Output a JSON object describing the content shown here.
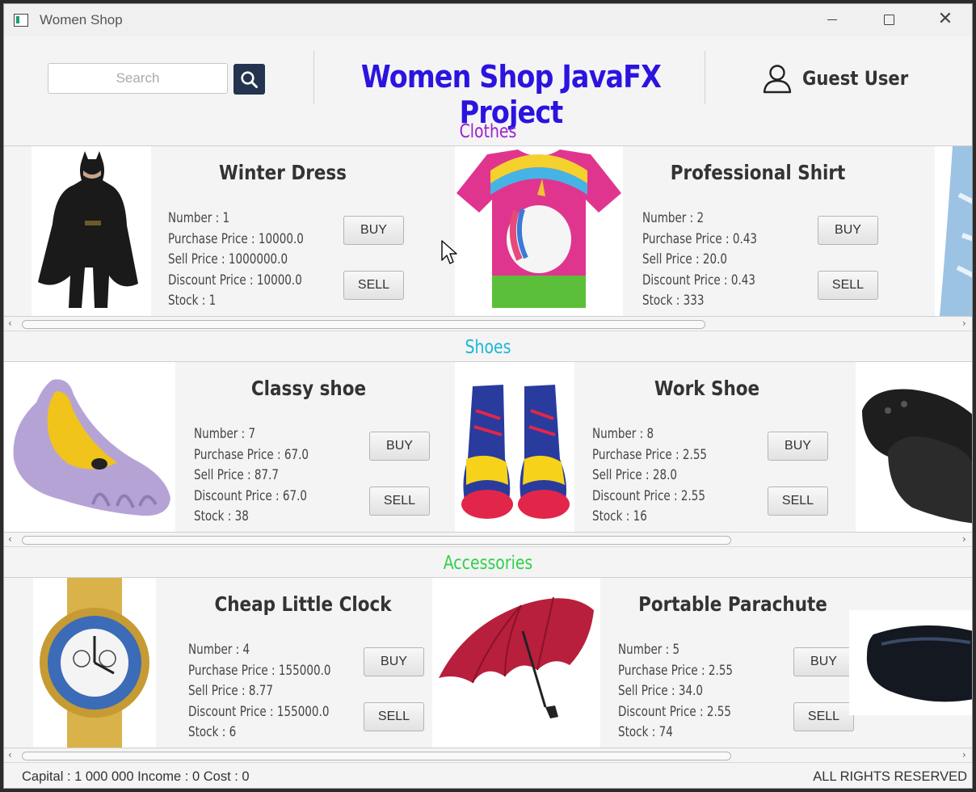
{
  "window": {
    "title": "Women Shop"
  },
  "header": {
    "search_placeholder": "Search",
    "title": "Women Shop JavaFX Project",
    "user": "Guest User"
  },
  "sections": [
    {
      "title": "Clothes",
      "color": "#9a1fd0",
      "products": [
        {
          "name": "Winter Dress",
          "number": "Number : 1",
          "purchase": "Purchase Price : 10000.0",
          "sell": "Sell Price : 1000000.0",
          "discount": "Discount Price : 10000.0",
          "stock": "Stock : 1",
          "buy_label": "BUY",
          "sell_label": "SELL",
          "image": "batman-costume"
        },
        {
          "name": "Professional Shirt",
          "number": "Number : 2",
          "purchase": "Purchase Price : 0.43",
          "sell": "Sell Price : 20.0",
          "discount": "Discount Price : 0.43",
          "stock": "Stock : 333",
          "buy_label": "BUY",
          "sell_label": "SELL",
          "image": "unicorn-tshirt"
        }
      ]
    },
    {
      "title": "Shoes",
      "color": "#1ab7d8",
      "products": [
        {
          "name": "Classy shoe",
          "number": "Number : 7",
          "purchase": "Purchase Price : 67.0",
          "sell": "Sell Price : 87.7",
          "discount": "Discount Price : 67.0",
          "stock": "Stock : 38",
          "buy_label": "BUY",
          "sell_label": "SELL",
          "image": "toe-shoe"
        },
        {
          "name": "Work Shoe",
          "number": "Number : 8",
          "purchase": "Purchase Price : 2.55",
          "sell": "Sell Price : 28.0",
          "discount": "Discount Price : 2.55",
          "stock": "Stock : 16",
          "buy_label": "BUY",
          "sell_label": "SELL",
          "image": "clown-boots"
        }
      ]
    },
    {
      "title": "Accessories",
      "color": "#2ed14a",
      "products": [
        {
          "name": "Cheap Little Clock",
          "number": "Number : 4",
          "purchase": "Purchase Price : 155000.0",
          "sell": "Sell Price : 8.77",
          "discount": "Discount Price : 155000.0",
          "stock": "Stock : 6",
          "buy_label": "BUY",
          "sell_label": "SELL",
          "image": "gold-watch"
        },
        {
          "name": "Portable Parachute",
          "number": "Number : 5",
          "purchase": "Purchase Price : 2.55",
          "sell": "Sell Price : 34.0",
          "discount": "Discount Price : 2.55",
          "stock": "Stock : 74",
          "buy_label": "BUY",
          "sell_label": "SELL",
          "image": "red-umbrella"
        }
      ]
    }
  ],
  "footer": {
    "left": "Capital : 1 000 000 Income : 0  Cost : 0",
    "right": "ALL RIGHTS RESERVED"
  },
  "icons": [
    "search-icon",
    "user-icon",
    "minimize-icon",
    "maximize-icon",
    "close-icon",
    "cursor-icon"
  ]
}
